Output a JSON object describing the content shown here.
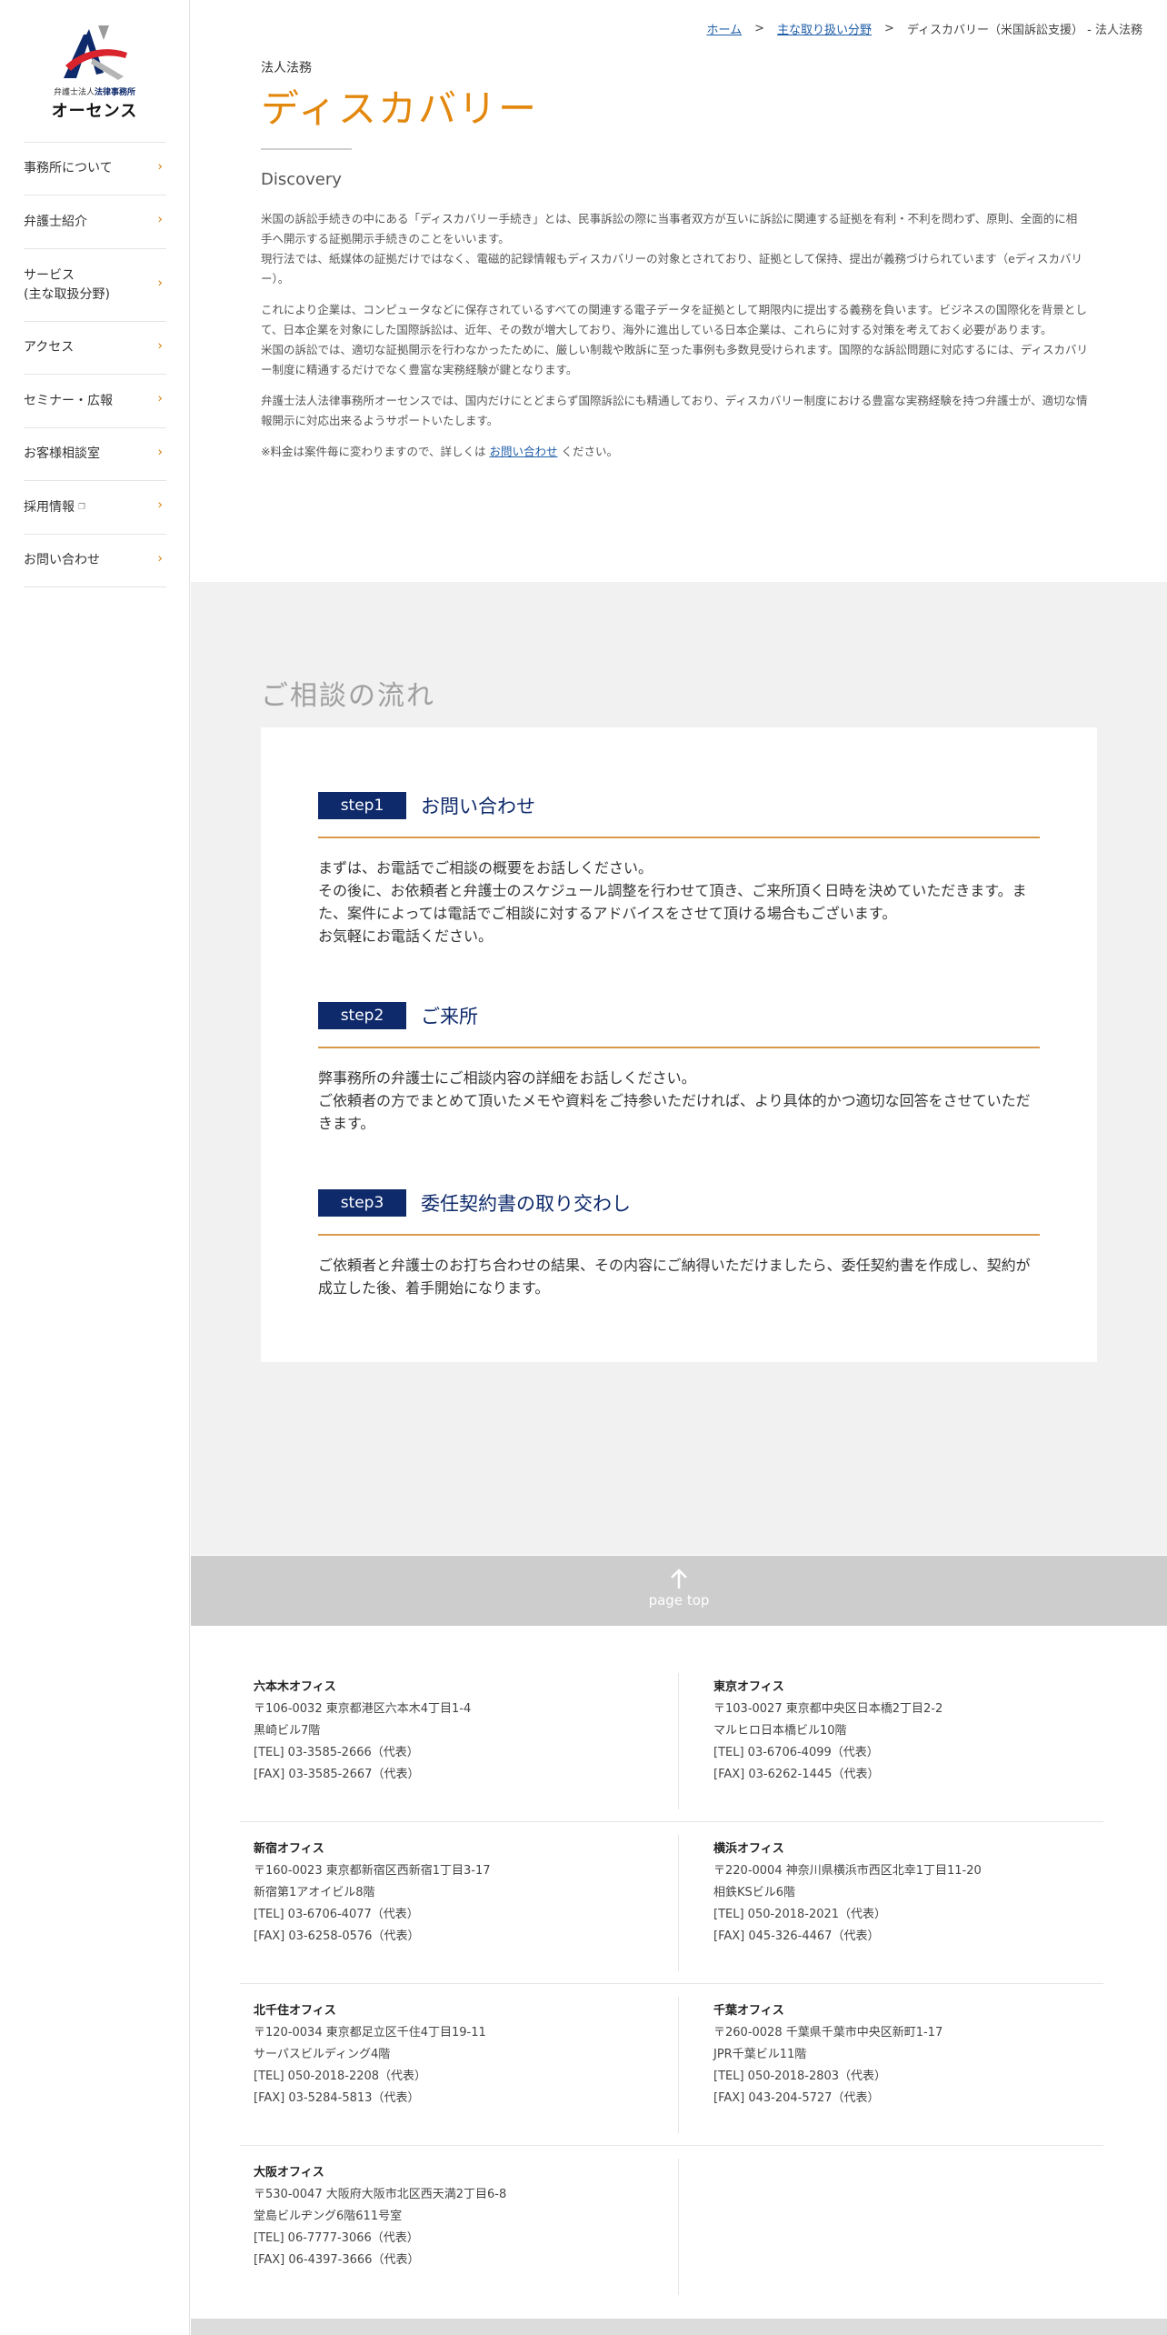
{
  "sidebar": {
    "logo": {
      "sub_prefix": "弁護士法人",
      "sub_bold": "法律事務所",
      "name": "オーセンス"
    },
    "items": [
      {
        "label": "事務所について"
      },
      {
        "label": "弁護士紹介"
      },
      {
        "label": "サービス\n(主な取扱分野)"
      },
      {
        "label": "アクセス"
      },
      {
        "label": "セミナー・広報"
      },
      {
        "label": "お客様相談室"
      },
      {
        "label": "採用情報",
        "external": true
      },
      {
        "label": "お問い合わせ"
      }
    ]
  },
  "breadcrumb": {
    "home": "ホーム",
    "sep1": ">",
    "category": "主な取り扱い分野",
    "sep2": ">",
    "current": "ディスカバリー（米国訴訟支援） - 法人法務"
  },
  "header": {
    "category": "法人法務",
    "title": "ディスカバリー",
    "subtitle_en": "Discovery"
  },
  "body": {
    "p1": "米国の訴訟手続きの中にある「ディスカバリー手続き」とは、民事訴訟の際に当事者双方が互いに訴訟に関連する証拠を有利・不利を問わず、原則、全面的に相手へ開示する証拠開示手続きのことをいいます。\n現行法では、紙媒体の証拠だけではなく、電磁的記録情報もディスカバリーの対象とされており、証拠として保持、提出が義務づけられています（eディスカバリー）。",
    "p2": "これにより企業は、コンピュータなどに保存されているすべての関連する電子データを証拠として期限内に提出する義務を負います。ビジネスの国際化を背景として、日本企業を対象にした国際訴訟は、近年、その数が増大しており、海外に進出している日本企業は、これらに対する対策を考えておく必要があります。\n米国の訴訟では、適切な証拠開示を行わなかったために、厳しい制裁や敗訴に至った事例も多数見受けられます。国際的な訴訟問題に対応するには、ディスカバリー制度に精通するだけでなく豊富な実務経験が鍵となります。",
    "p3": "弁護士法人法律事務所オーセンスでは、国内だけにとどまらず国際訴訟にも精通しており、ディスカバリー制度における豊富な実務経験を持つ弁護士が、適切な情報開示に対応出来るようサポートいたします。",
    "note_before": "※料金は案件毎に変わりますので、詳しくは",
    "note_link": "お問い合わせ",
    "note_after": "ください。"
  },
  "flow": {
    "heading": "ご相談の流れ",
    "steps": [
      {
        "badge": "step1",
        "title": "お問い合わせ",
        "text": "まずは、お電話でご相談の概要をお話しください。\nその後に、お依頼者と弁護士のスケジュール調整を行わせて頂き、ご来所頂く日時を決めていただきます。また、案件によっては電話でご相談に対するアドバイスをさせて頂ける場合もございます。\nお気軽にお電話ください。"
      },
      {
        "badge": "step2",
        "title": "ご来所",
        "text": "弊事務所の弁護士にご相談内容の詳細をお話しください。\nご依頼者の方でまとめて頂いたメモや資料をご持参いただければ、より具体的かつ適切な回答をさせていただきます。"
      },
      {
        "badge": "step3",
        "title": "委任契約書の取り交わし",
        "text": "ご依頼者と弁護士のお打ち合わせの結果、その内容にご納得いただけましたら、委任契約書を作成し、契約が成立した後、着手開始になります。"
      }
    ]
  },
  "pagetop": {
    "label": "page top"
  },
  "offices": [
    {
      "name": "六本木オフィス",
      "lines": [
        "〒106-0032 東京都港区六本木4丁目1-4",
        "黒崎ビル7階",
        "[TEL] 03-3585-2666（代表）",
        "[FAX] 03-3585-2667（代表）"
      ]
    },
    {
      "name": "東京オフィス",
      "lines": [
        "〒103-0027 東京都中央区日本橋2丁目2-2",
        "マルヒロ日本橋ビル10階",
        "[TEL] 03-6706-4099（代表）",
        "[FAX] 03-6262-1445（代表）"
      ]
    },
    {
      "name": "新宿オフィス",
      "lines": [
        "〒160-0023 東京都新宿区西新宿1丁目3-17",
        "新宿第1アオイビル8階",
        "[TEL] 03-6706-4077（代表）",
        "[FAX] 03-6258-0576（代表）"
      ]
    },
    {
      "name": "横浜オフィス",
      "lines": [
        "〒220-0004 神奈川県横浜市西区北幸1丁目11-20",
        "相鉄KSビル6階",
        "[TEL] 050-2018-2021（代表）",
        "[FAX] 045-326-4467（代表）"
      ]
    },
    {
      "name": "北千住オフィス",
      "lines": [
        "〒120-0034 東京都足立区千住4丁目19-11",
        "サーパスビルディング4階",
        "[TEL] 050-2018-2208（代表）",
        "[FAX] 03-5284-5813（代表）"
      ]
    },
    {
      "name": "千葉オフィス",
      "lines": [
        "〒260-0028 千葉県千葉市中央区新町1-17",
        "JPR千葉ビル11階",
        "[TEL] 050-2018-2803（代表）",
        "[FAX] 043-204-5727（代表）"
      ]
    },
    {
      "name": "大阪オフィス",
      "lines": [
        "〒530-0047 大阪府大阪市北区西天満2丁目6-8",
        "堂島ビルヂング6階611号室",
        "[TEL] 06-7777-3066（代表）",
        "[FAX] 06-4397-3666（代表）"
      ]
    }
  ],
  "colors": {
    "accent_orange": "#e3880e",
    "navy": "#0e2a6b",
    "link_blue": "#1f5ea8"
  }
}
